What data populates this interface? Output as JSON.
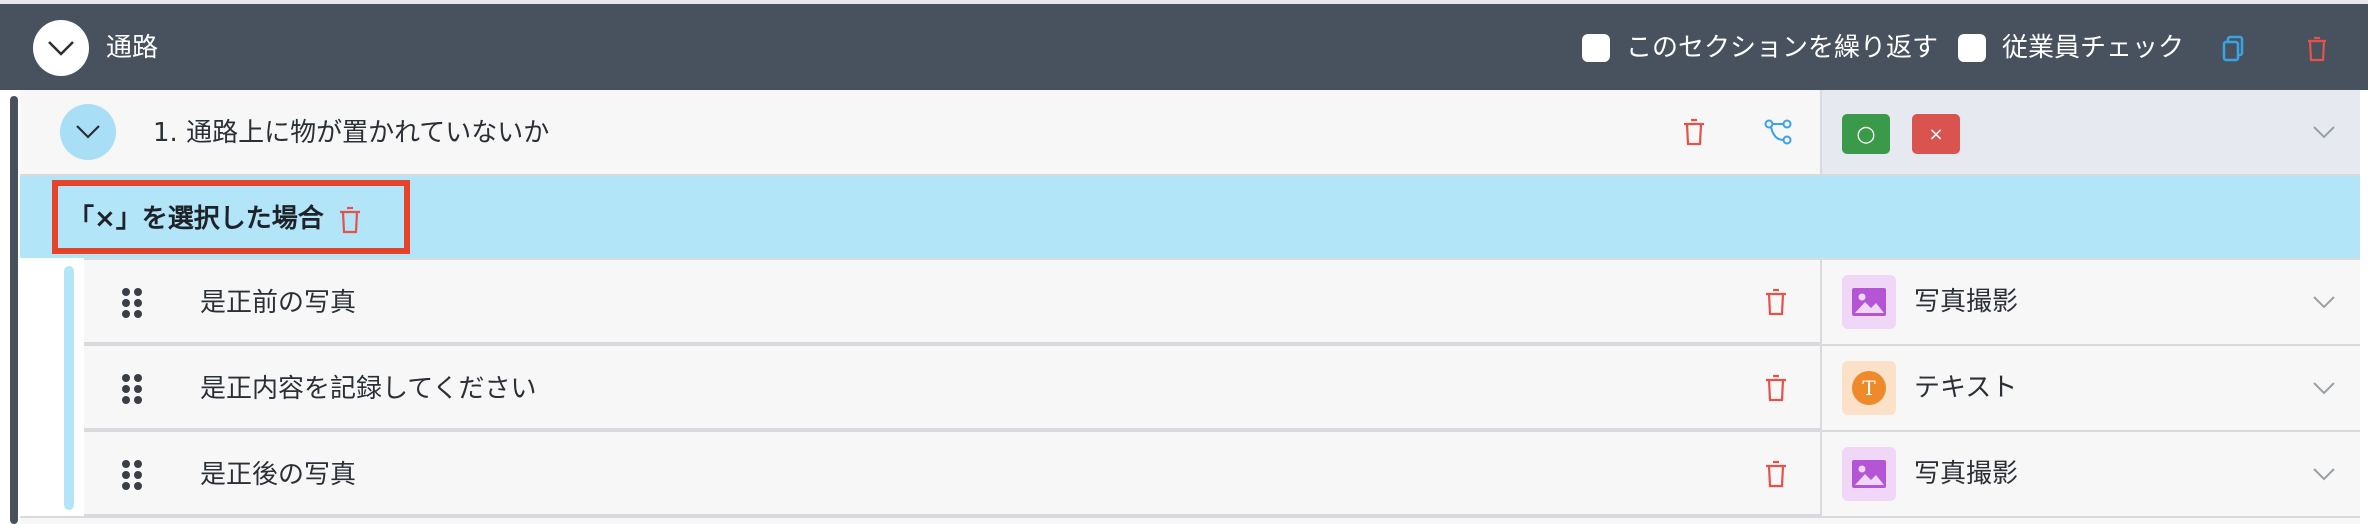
{
  "section": {
    "title": "通路",
    "repeat_label": "このセクションを繰り返す",
    "employee_check_label": "従業員チェック"
  },
  "question": {
    "text": "1. 通路上に物が置かれていないか",
    "answer_ok": "○",
    "answer_ng": "×"
  },
  "condition": {
    "label": "「×」を選択した場合"
  },
  "items": [
    {
      "text": "是正前の写真",
      "type_label": "写真撮影",
      "type_icon": "image-icon"
    },
    {
      "text": "是正内容を記録してください",
      "type_label": "テキスト",
      "type_icon": "text-icon",
      "type_icon_glyph": "T"
    },
    {
      "text": "是正後の写真",
      "type_label": "写真撮影",
      "type_icon": "image-icon"
    }
  ],
  "colors": {
    "header_bg": "#48525f",
    "condition_bg": "#b2e5f8",
    "highlight_border": "#e5432a",
    "delete_red": "#e5524a",
    "ok_green": "#3a9a4a",
    "ng_red": "#d9534f"
  }
}
